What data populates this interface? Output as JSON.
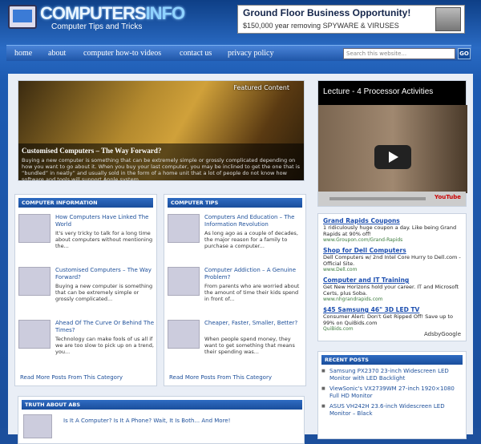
{
  "header": {
    "logo_main": "COMPUTERS",
    "logo_accent": "INFO",
    "tagline": "Computer Tips and Tricks",
    "ad_title": "Ground Floor Business Opportunity!",
    "ad_sub": "$150,000 year removing SPYWARE & VIRUSES"
  },
  "nav": {
    "items": [
      "home",
      "about",
      "computer how-to videos",
      "contact us",
      "privacy policy"
    ],
    "search_placeholder": "Search this website...",
    "go": "GO"
  },
  "featured": {
    "label": "Featured Content",
    "title": "Customised Computers – The Way Forward?",
    "text": "Buying a new computer is something that can be extremely simple or grossly complicated depending on how you want to go about it. When you buy your last computer, you may be inclined to get the one that is “bundled” in neatly” and usually sold in the form of a home unit that a lot of people do not know how software and tools will support Apple system."
  },
  "video": {
    "title": "Lecture - 4 Processor Activities",
    "brand": "YouTube"
  },
  "col1": {
    "header": "COMPUTER INFORMATION",
    "posts": [
      {
        "title": "How Computers Have Linked The World",
        "desc": "It's very tricky to talk for a long time about computers without mentioning the..."
      },
      {
        "title": "Customised Computers – The Way Forward?",
        "desc": "Buying a new computer is something that can be extremely simple or grossly complicated..."
      },
      {
        "title": "Ahead Of The Curve Or Behind The Times?",
        "desc": "Technology can make fools of us all if we are too slow to pick up on a trend, you..."
      }
    ],
    "more": "Read More Posts From This Category"
  },
  "col2": {
    "header": "COMPUTER TIPS",
    "posts": [
      {
        "title": "Computers And Education – The Information Revolution",
        "desc": "As long ago as a couple of decades, the major reason for a family to purchase a computer..."
      },
      {
        "title": "Computer Addiction – A Genuine Problem?",
        "desc": "From parents who are worried about the amount of time their kids spend in front of..."
      },
      {
        "title": "Cheaper, Faster, Smaller, Better?",
        "desc": "When people spend money, they want to get something that means their spending was..."
      }
    ],
    "more": "Read More Posts From This Category"
  },
  "ads": {
    "items": [
      {
        "title": "Grand Rapids Coupons",
        "desc": "1 ridiculously huge coupon a day. Like being Grand Rapids at 90% off!",
        "url": "www.Groupon.com/Grand-Rapids"
      },
      {
        "title": "Shop for Dell Computers",
        "desc": "Dell Computers w/ 2nd Intel Core Hurry to Dell.com - Official Site.",
        "url": "www.Dell.com"
      },
      {
        "title": "Computer and IT Training",
        "desc": "Get New Horizons hold your career. IT and Microsoft Certs, plus Soba.",
        "url": "www.nhgrandrapids.com"
      },
      {
        "title": "$45 Samsung 46\" 3D LED TV",
        "desc": "Consumer Alert: Don't Get Ripped Off! Save up to 99% on QuiBids.com",
        "url": "QuiBids.com"
      }
    ],
    "footer": "AdsbyGoogle"
  },
  "recent": {
    "header": "RECENT POSTS",
    "items": [
      "Samsung PX2370 23-inch Widescreen LED Monitor with LED Backlight",
      "ViewSonic's VX2739WM 27-inch 1920×1080 Full HD Monitor",
      "ASUS VH242H 23.6-inch Widescreen LED Monitor – Black"
    ]
  },
  "truth": {
    "header": "TRUTH ABOUT ABS",
    "title": "Is It A Computer? Is It A Phone? Wait, It Is Both... And More!"
  }
}
